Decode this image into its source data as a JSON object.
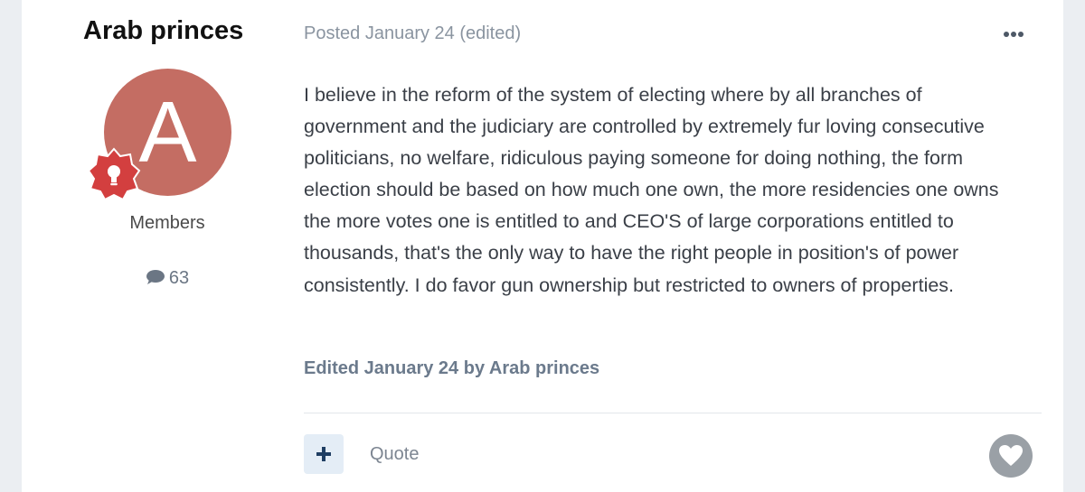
{
  "author": {
    "name": "Arab princes",
    "avatar_letter": "A",
    "avatar_color": "#c46d63",
    "rank_badge_icon": "lightbulb-icon",
    "rank_badge_color": "#d33f3f",
    "group": "Members",
    "post_count_icon": "comment-icon",
    "post_count": "63"
  },
  "post": {
    "meta": "Posted January 24 (edited)",
    "menu_icon": "more-options-icon",
    "body": "I believe in the reform of the system of electing  where by all branches of government and the judiciary are controlled by extremely fur loving consecutive politicians, no welfare, ridiculous paying someone for doing nothing, the form election should be based on how much one own, the more residencies one owns the more votes  one is entitled to and CEO'S of large corporations entitled to thousands, that's the only way to have the right people in position's of power consistently. I do favor  gun ownership but restricted to owners of properties.",
    "edit_note": "Edited January 24 by Arab princes"
  },
  "actions": {
    "plus_icon": "plus-icon",
    "quote_label": "Quote",
    "react_icon": "heart-icon"
  }
}
